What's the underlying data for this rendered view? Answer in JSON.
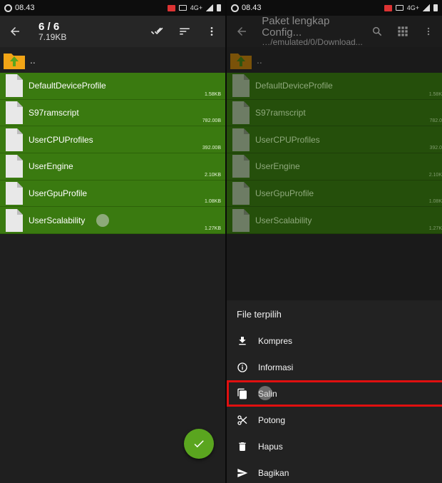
{
  "left": {
    "status": {
      "time": "08.43",
      "network": "4G+"
    },
    "toolbar": {
      "title": "6 / 6",
      "subtitle": "7.19KB"
    },
    "parent_label": "..",
    "files": [
      {
        "name": "DefaultDeviceProfile",
        "size": "1.58KB"
      },
      {
        "name": "S97ramscript",
        "size": "782.00B"
      },
      {
        "name": "UserCPUProfiles",
        "size": "392.00B"
      },
      {
        "name": "UserEngine",
        "size": "2.10KB"
      },
      {
        "name": "UserGpuProfile",
        "size": "1.08KB"
      },
      {
        "name": "UserScalability",
        "size": "1.27KB"
      }
    ]
  },
  "right": {
    "status": {
      "time": "08.43",
      "network": "4G+"
    },
    "toolbar": {
      "title": "Paket lengkap Config...",
      "subtitle": "…/emulated/0/Download..."
    },
    "parent_label": "..",
    "files": [
      {
        "name": "DefaultDeviceProfile",
        "size": "1.58K"
      },
      {
        "name": "S97ramscript",
        "size": "782.0"
      },
      {
        "name": "UserCPUProfiles",
        "size": "392.0"
      },
      {
        "name": "UserEngine",
        "size": "2.10K"
      },
      {
        "name": "UserGpuProfile",
        "size": "1.08K"
      },
      {
        "name": "UserScalability",
        "size": "1.27K"
      }
    ],
    "sheet": {
      "title": "File terpilih",
      "items": [
        {
          "label": "Kompres",
          "icon": "download-icon"
        },
        {
          "label": "Informasi",
          "icon": "info-icon"
        },
        {
          "label": "Salin",
          "icon": "copy-icon"
        },
        {
          "label": "Potong",
          "icon": "scissors-icon"
        },
        {
          "label": "Hapus",
          "icon": "trash-icon"
        },
        {
          "label": "Bagikan",
          "icon": "send-icon"
        }
      ]
    }
  },
  "colors": {
    "selected_row": "#3a7a10",
    "fab": "#5aa51f",
    "highlight": "#e01010"
  }
}
